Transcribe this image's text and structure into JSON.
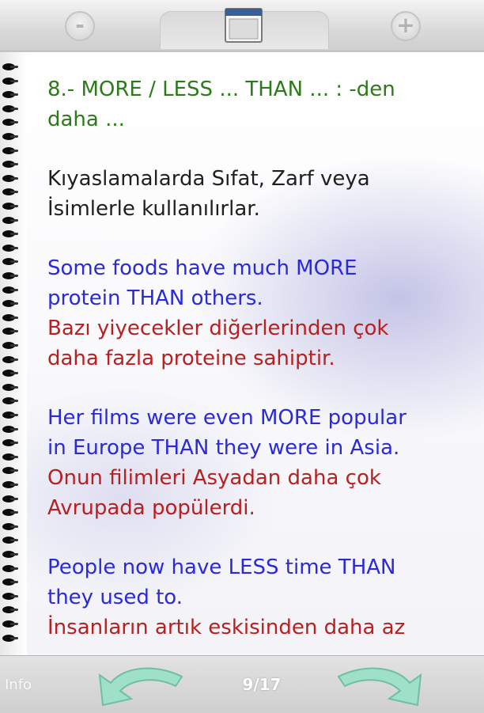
{
  "toolbar": {
    "zoom_out_label": "-",
    "zoom_in_label": "+"
  },
  "lesson": {
    "title_lines": [
      "8.- MORE / LESS ... THAN ... : -den",
      "daha ..."
    ],
    "explanation_lines": [
      "Kıyaslamalarda Sıfat, Zarf veya",
      "İsimlerle kullanılırlar."
    ],
    "examples": [
      {
        "english_lines": [
          "Some foods have much MORE",
          "protein THAN others."
        ],
        "turkish_lines": [
          "Bazı yiyecekler diğerlerinden çok",
          "daha fazla proteine sahiptir."
        ]
      },
      {
        "english_lines": [
          "Her films were even MORE popular",
          "in Europe THAN they were in Asia."
        ],
        "turkish_lines": [
          "Onun filimleri Asyadan daha çok",
          "Avrupada popülerdi."
        ]
      },
      {
        "english_lines": [
          "People now have LESS time THAN",
          "they used to."
        ],
        "turkish_lines": [
          "İnsanların artık eskisinden daha az"
        ]
      }
    ]
  },
  "footer": {
    "info_label": "Info",
    "page_counter": "9/17"
  },
  "colors": {
    "title": "#2d7a1a",
    "english": "#2a2ad8",
    "turkish": "#b82020",
    "arrow": "#9fe0c9"
  }
}
